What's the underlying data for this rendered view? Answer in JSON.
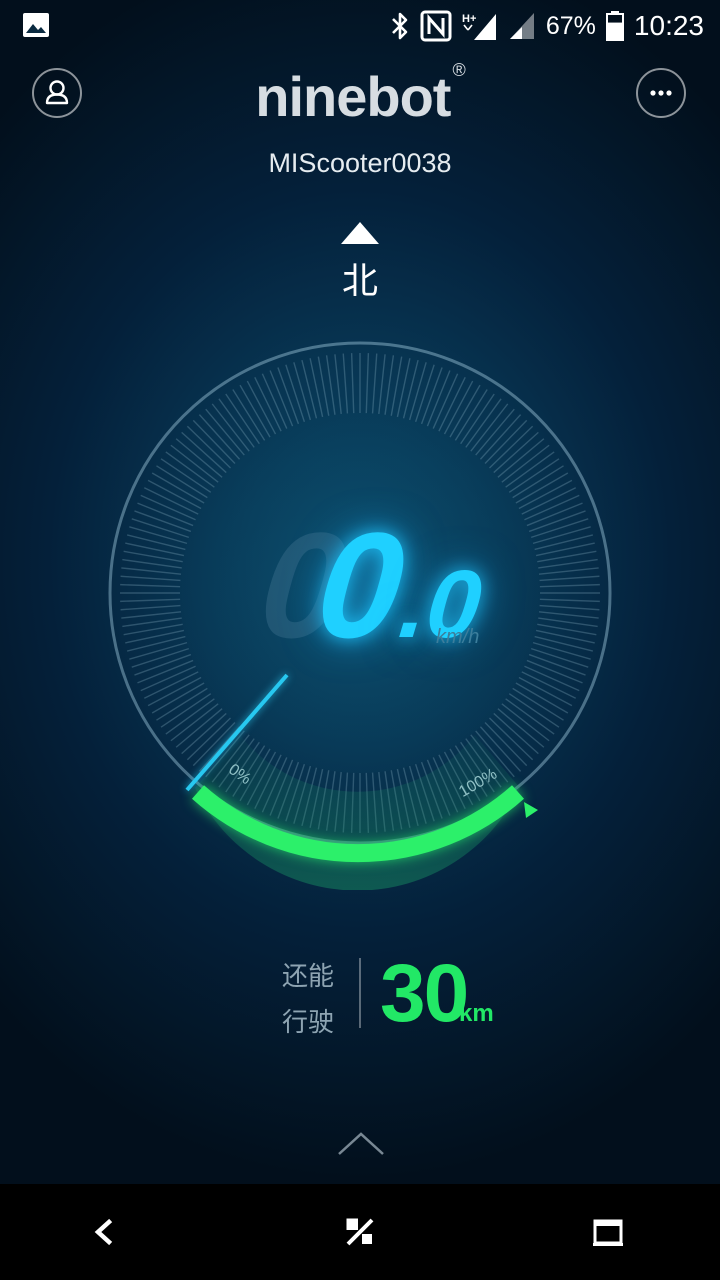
{
  "status_bar": {
    "left_icon": "image-icon",
    "icons": [
      "bluetooth-icon",
      "nfc-icon",
      "signal-hplus-icon",
      "signal-icon"
    ],
    "battery_percent": "67%",
    "battery_level": 0.67,
    "time": "10:23"
  },
  "header": {
    "logo_text": "ninebot",
    "logo_mark": "®",
    "device_name": "MIScooter0038",
    "profile_icon": "person-icon",
    "more_icon": "more-icon"
  },
  "compass": {
    "direction": "北"
  },
  "speedometer": {
    "ghost_digit": "0",
    "speed_integer": "0",
    "speed_decimal": ".0",
    "unit": "km/h",
    "battery_min_label": "0%",
    "battery_max_label": "100%",
    "battery_fraction": 1.0
  },
  "range": {
    "label_line1": "还能",
    "label_line2": "行驶",
    "value": "30",
    "unit": "km"
  },
  "colors": {
    "accent_blue": "#1fd0ff",
    "accent_green": "#22e866",
    "background": "#04203a"
  },
  "nav_bar": {
    "back_icon": "back-icon",
    "home_icon": "home-icon",
    "recents_icon": "recents-icon"
  }
}
